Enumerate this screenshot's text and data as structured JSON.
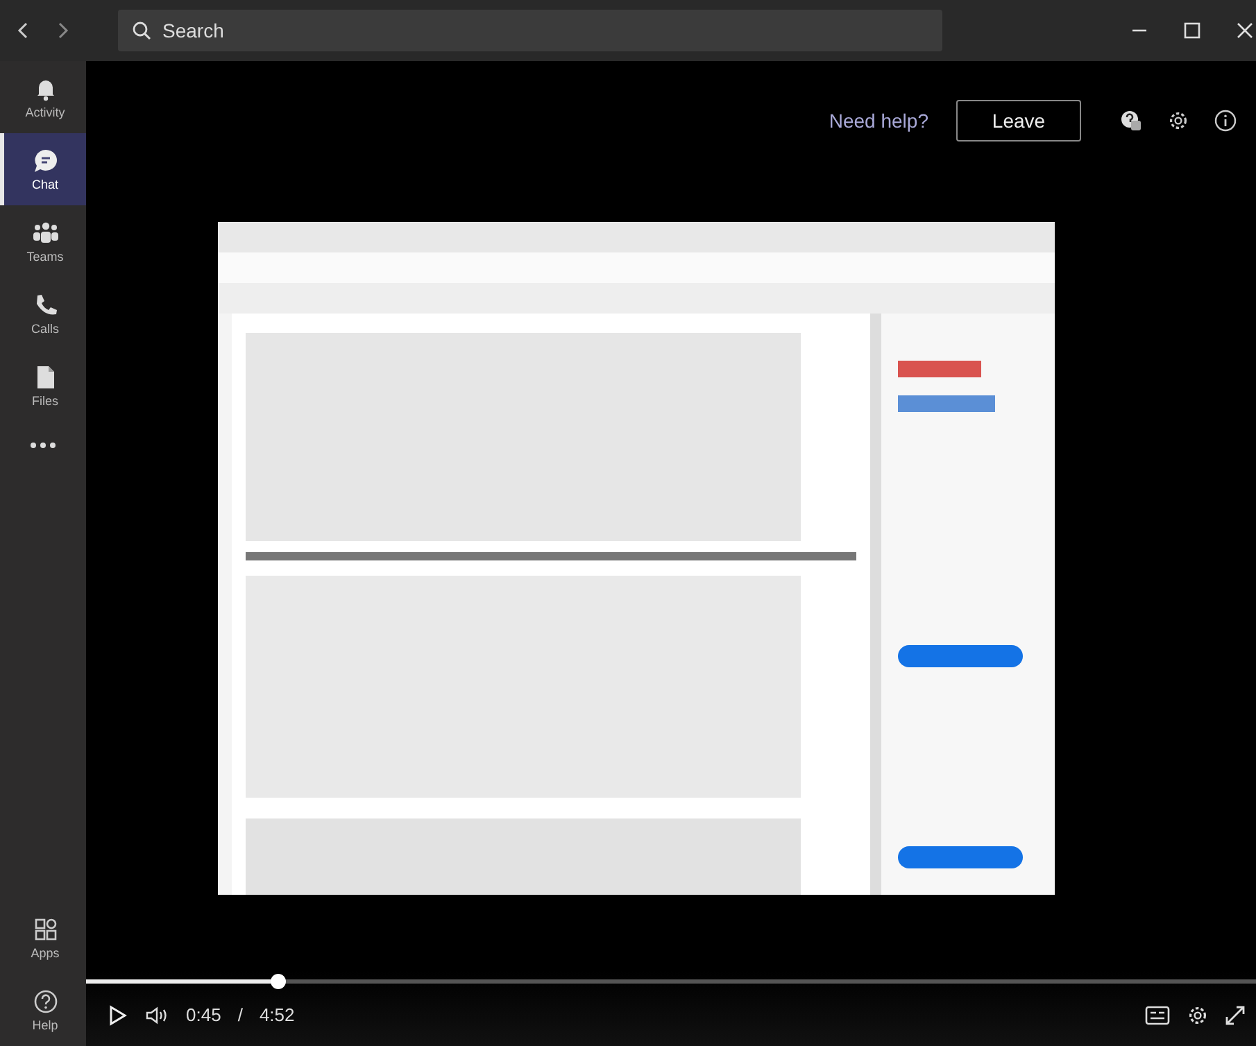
{
  "title_bar": {
    "search": {
      "placeholder": "Search"
    }
  },
  "sidebar": {
    "items": [
      {
        "kind": "bell",
        "label": "Activity",
        "selected": false
      },
      {
        "kind": "chat",
        "label": "Chat",
        "selected": true
      },
      {
        "kind": "teams",
        "label": "Teams",
        "selected": false
      },
      {
        "kind": "calls",
        "label": "Calls",
        "selected": false
      },
      {
        "kind": "files",
        "label": "Files",
        "selected": false
      }
    ],
    "bottom_items": [
      {
        "kind": "apps",
        "label": "Apps",
        "selected": false
      },
      {
        "kind": "help",
        "label": "Help",
        "selected": false
      }
    ]
  },
  "meeting_bar": {
    "help_link": "Need help?",
    "leave_button": "Leave"
  },
  "player": {
    "progress": {
      "level": 0.164
    },
    "time": "0:45",
    "separator": "/",
    "duration": "4:52"
  }
}
